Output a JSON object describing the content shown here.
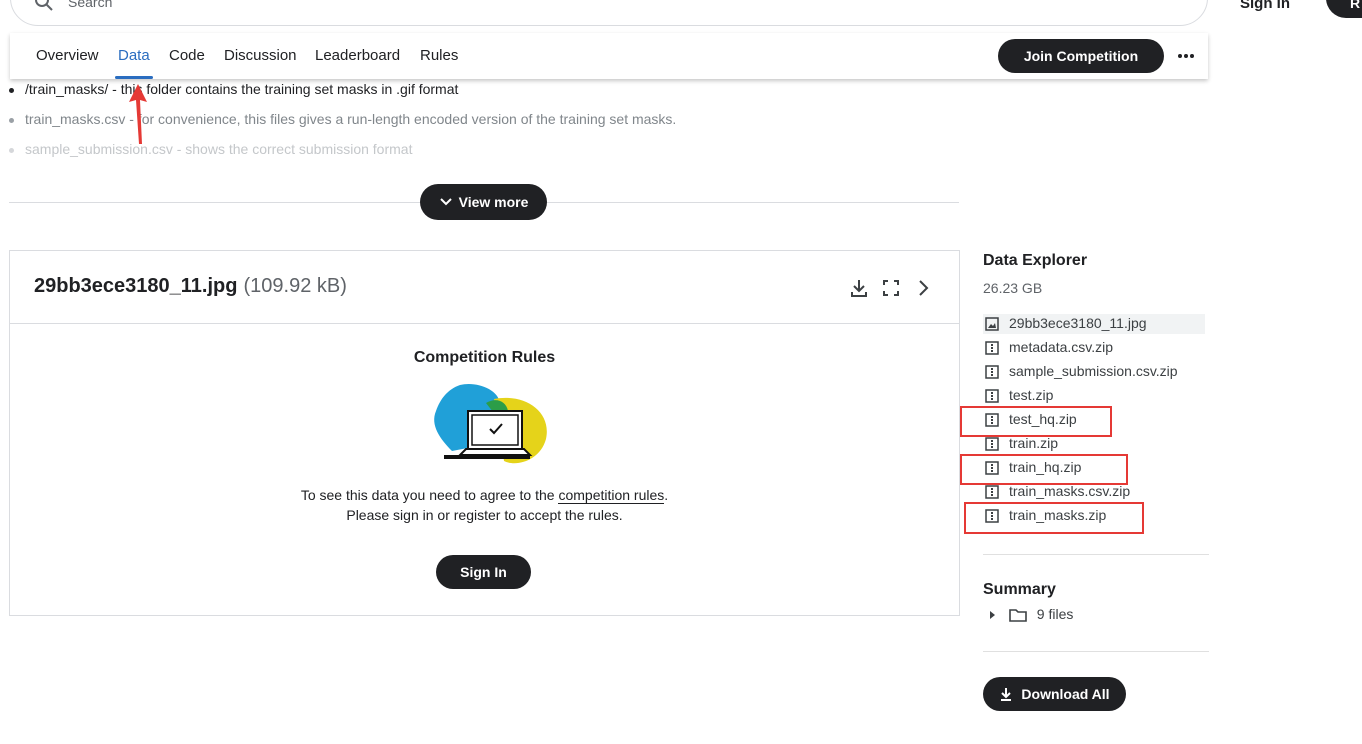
{
  "header": {
    "search_placeholder": "Search",
    "sign_in_label": "Sign In",
    "register_label": "R"
  },
  "tabs": [
    {
      "label": "Overview"
    },
    {
      "label": "Data",
      "active": true
    },
    {
      "label": "Code"
    },
    {
      "label": "Discussion"
    },
    {
      "label": "Leaderboard"
    },
    {
      "label": "Rules"
    }
  ],
  "join_button_label": "Join Competition",
  "description": {
    "bullets": [
      "/train_masks/ - this folder contains the training set masks in .gif format",
      "train_masks.csv - for convenience, this files gives a run-length encoded version of the training set masks.",
      "sample_submission.csv - shows the correct submission format"
    ],
    "view_more_label": "View more"
  },
  "preview": {
    "file_name": "29bb3ece3180_11.jpg",
    "file_size": "(109.92 kB)",
    "rules_title": "Competition Rules",
    "rules_text_before": "To see this data you need to agree to the ",
    "rules_link": "competition rules",
    "rules_text_after": ".",
    "rules_text_line2": "Please sign in or register to accept the rules.",
    "sign_in_label": "Sign In"
  },
  "data_explorer": {
    "title": "Data Explorer",
    "total_size": "26.23 GB",
    "files": [
      {
        "name": "29bb3ece3180_11.jpg",
        "icon": "image-icon",
        "selected": true
      },
      {
        "name": "metadata.csv.zip",
        "icon": "zip-icon"
      },
      {
        "name": "sample_submission.csv.zip",
        "icon": "zip-icon"
      },
      {
        "name": "test.zip",
        "icon": "zip-icon"
      },
      {
        "name": "test_hq.zip",
        "icon": "zip-icon",
        "highlighted": true
      },
      {
        "name": "train.zip",
        "icon": "zip-icon"
      },
      {
        "name": "train_hq.zip",
        "icon": "zip-icon",
        "highlighted": true
      },
      {
        "name": "train_masks.csv.zip",
        "icon": "zip-icon"
      },
      {
        "name": "train_masks.zip",
        "icon": "zip-icon",
        "highlighted": true
      }
    ]
  },
  "summary": {
    "title": "Summary",
    "files_count_label": "9 files"
  },
  "download_all_label": "Download All",
  "colors": {
    "accent_blue": "#2a6dc0",
    "dark_button": "#202124",
    "annotation_red": "#e53935"
  }
}
